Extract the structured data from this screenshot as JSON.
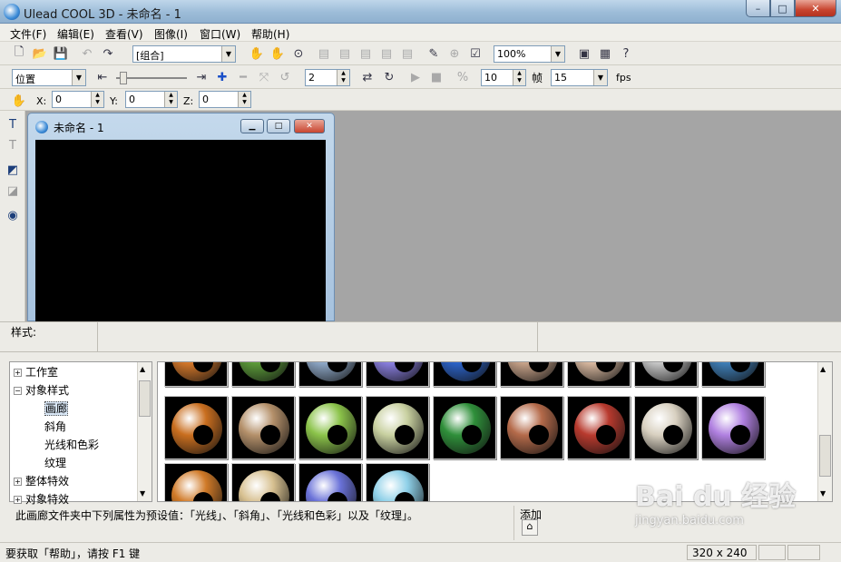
{
  "window": {
    "app_title": "Ulead COOL 3D - 未命名 - 1",
    "min": "–",
    "max": "□",
    "close": "✕"
  },
  "menus": [
    "文件(F)",
    "编辑(E)",
    "查看(V)",
    "图像(I)",
    "窗口(W)",
    "帮助(H)"
  ],
  "toolbar1": {
    "object_combo": "[组合]",
    "zoom_combo": "100%"
  },
  "toolbar2": {
    "prop_combo": "位置",
    "frame_value": "2",
    "frames_value": "10",
    "frame_label": "帧",
    "fps_value": "15",
    "fps_label": "fps"
  },
  "toolbar3": {
    "x_label": "X:",
    "x_value": "0",
    "y_label": "Y:",
    "y_value": "0",
    "z_label": "Z:",
    "z_value": "0"
  },
  "child_window": {
    "title": "未命名 - 1"
  },
  "style_bar": {
    "label": "样式:"
  },
  "tree": [
    {
      "label": "工作室",
      "level": 0,
      "expander": "+"
    },
    {
      "label": "对象样式",
      "level": 0,
      "expander": "−"
    },
    {
      "label": "画廊",
      "level": 1,
      "selected": true
    },
    {
      "label": "斜角",
      "level": 1
    },
    {
      "label": "光线和色彩",
      "level": 1
    },
    {
      "label": "纹理",
      "level": 1
    },
    {
      "label": "整体特效",
      "level": 0,
      "expander": "+"
    },
    {
      "label": "对象特效",
      "level": 0,
      "expander": "+"
    }
  ],
  "gallery_colors": [
    [
      "#d5782a",
      "#5c9c3a",
      "#8fa9c8",
      "#8a7fe0",
      "#2c63c9",
      "#c9a48a",
      "#d9b9a0",
      "#c9c9c9",
      "#3f7fb8"
    ],
    [
      "#c96e1f",
      "#b4906a",
      "#8bc34a",
      "#c8d0a0",
      "#2f8f3a",
      "#b46a4a",
      "#b83a2e",
      "#d8d0c0",
      "#b080e0"
    ],
    [
      "#d07a28",
      "#d7c090",
      "#6a72d8",
      "#8ed0e8"
    ]
  ],
  "description": "此画廊文件夹中下列属性为预设值：「光线」、「斜角」、「光线和色彩」以及「纹理」。",
  "add_label": "添加",
  "status": {
    "help_text": "要获取「帮助」，请按 F1 键",
    "size": "320 x 240"
  },
  "watermark": {
    "brand": "Bai du 经验",
    "url": "jingyan.baidu.com"
  }
}
